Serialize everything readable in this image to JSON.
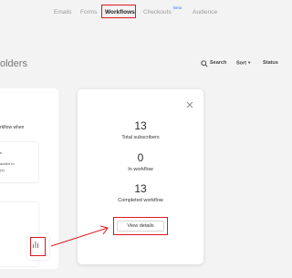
{
  "nav": {
    "items": [
      {
        "label": "Emails"
      },
      {
        "label": "Forms"
      },
      {
        "label": "Workflows",
        "active": true
      },
      {
        "label": "Checkouts"
      },
      {
        "label": "Audience"
      }
    ],
    "beta_badge": "Beta"
  },
  "page": {
    "title_fragment": "olders"
  },
  "toolbar": {
    "search_label": "Search",
    "sort_label": "Sort",
    "status_label": "Status"
  },
  "workflow_canvas": {
    "trigger_text": "rkflow when",
    "card_lines": [
      "e",
      "added to",
      "(s)"
    ]
  },
  "stats_popup": {
    "stats": [
      {
        "value": "13",
        "label": "Total subscribers"
      },
      {
        "value": "0",
        "label": "In workflow"
      },
      {
        "value": "13",
        "label": "Completed workflow"
      }
    ],
    "view_details_label": "View details"
  },
  "colors": {
    "highlight": "#e0171f",
    "beta": "#3b82f6",
    "background": "#f3f3f4"
  },
  "icons": [
    "search-icon",
    "chevron-down-icon",
    "close-icon",
    "stats-icon",
    "arrow-annotation"
  ]
}
